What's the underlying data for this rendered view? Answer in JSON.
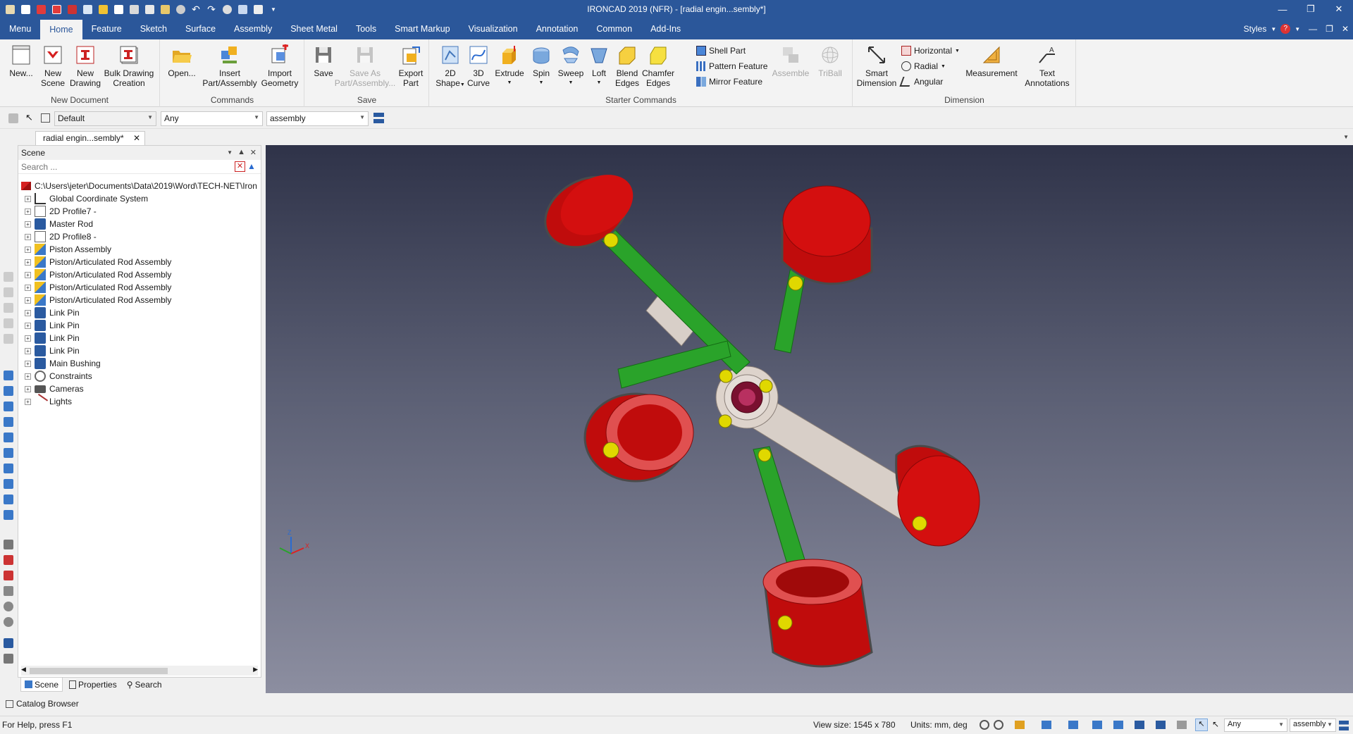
{
  "titlebar": {
    "title": "IRONCAD 2019 (NFR) - [radial engin...sembly*]",
    "qat_icons": [
      "app-logo-icon",
      "new-icon",
      "new-scene-icon",
      "save-icon",
      "open-icon",
      "export-icon",
      "properties-icon",
      "print-icon",
      "settings-icon",
      "tool-icon",
      "undo-icon",
      "redo-icon",
      "sphere-icon",
      "grid-icon",
      "menu-icon"
    ]
  },
  "menu_tabs": [
    "Menu",
    "Home",
    "Feature",
    "Sketch",
    "Surface",
    "Assembly",
    "Sheet Metal",
    "Tools",
    "Smart Markup",
    "Visualization",
    "Annotation",
    "Common",
    "Add-Ins"
  ],
  "active_tab": "Home",
  "styles_label": "Styles",
  "ribbon": {
    "new_document": {
      "label": "New Document",
      "new": "New...",
      "new_scene": [
        "New",
        "Scene"
      ],
      "new_drawing": [
        "New",
        "Drawing"
      ],
      "bulk": [
        "Bulk Drawing",
        "Creation"
      ]
    },
    "commands": {
      "label": "Commands",
      "open": "Open...",
      "insert": [
        "Insert",
        "Part/Assembly"
      ],
      "import": [
        "Import",
        "Geometry"
      ]
    },
    "save": {
      "label": "Save",
      "save": "Save",
      "save_as": [
        "Save As",
        "Part/Assembly..."
      ],
      "export": [
        "Export",
        "Part"
      ]
    },
    "starter": {
      "label": "Starter Commands",
      "shape2d": [
        "2D",
        "Shape"
      ],
      "curve3d": [
        "3D",
        "Curve"
      ],
      "extrude": "Extrude",
      "spin": "Spin",
      "sweep": "Sweep",
      "loft": "Loft",
      "blend": [
        "Blend",
        "Edges"
      ],
      "chamfer": [
        "Chamfer",
        "Edges"
      ],
      "shell": "Shell Part",
      "pattern": "Pattern Feature",
      "mirror": "Mirror Feature",
      "assemble": "Assemble",
      "triball": "TriBall"
    },
    "dimension": {
      "label": "Dimension",
      "smart": [
        "Smart",
        "Dimension"
      ],
      "horizontal": "Horizontal",
      "radial": "Radial",
      "angular": "Angular",
      "measurement": "Measurement",
      "text": [
        "Text",
        "Annotations"
      ]
    }
  },
  "subtoolbar": {
    "style_combo": "Default",
    "filter_combo": "Any",
    "level_combo": "assembly"
  },
  "document_tab": "radial engin...sembly*",
  "scene_panel": {
    "title": "Scene",
    "search_placeholder": "Search ...",
    "root": "C:\\Users\\jeter\\Documents\\Data\\2019\\Word\\TECH-NET\\Iron",
    "items": [
      {
        "label": "Global Coordinate System",
        "icon": "coordinate-system-icon"
      },
      {
        "label": "2D Profile7 -",
        "icon": "profile-icon"
      },
      {
        "label": "Master Rod",
        "icon": "part-icon"
      },
      {
        "label": "2D Profile8 -",
        "icon": "profile-icon"
      },
      {
        "label": "Piston Assembly",
        "icon": "assembly-icon"
      },
      {
        "label": "Piston/Articulated Rod Assembly",
        "icon": "assembly-icon"
      },
      {
        "label": "Piston/Articulated Rod Assembly",
        "icon": "assembly-icon"
      },
      {
        "label": "Piston/Articulated Rod Assembly",
        "icon": "assembly-icon"
      },
      {
        "label": "Piston/Articulated Rod Assembly",
        "icon": "assembly-icon"
      },
      {
        "label": "Link Pin",
        "icon": "part-icon"
      },
      {
        "label": "Link Pin",
        "icon": "part-icon"
      },
      {
        "label": "Link Pin",
        "icon": "part-icon"
      },
      {
        "label": "Link Pin",
        "icon": "part-icon"
      },
      {
        "label": "Main Bushing",
        "icon": "part-icon"
      },
      {
        "label": "Constraints",
        "icon": "constraints-icon"
      },
      {
        "label": "Cameras",
        "icon": "cameras-icon"
      },
      {
        "label": "Lights",
        "icon": "lights-icon"
      }
    ],
    "tabs": [
      "Scene",
      "Properties",
      "Search"
    ]
  },
  "catalog_browser": "Catalog Browser",
  "statusbar": {
    "help": "For Help, press F1",
    "view_size": "View size: 1545 x  780",
    "units": "Units: mm, deg",
    "filter": "Any",
    "level": "assembly"
  },
  "colors": {
    "title_bg": "#2b579a",
    "piston_red": "#d40f0f",
    "rod_green": "#2aa32a",
    "master_rod": "#d8cfc8",
    "pin_yellow": "#e0d800"
  }
}
